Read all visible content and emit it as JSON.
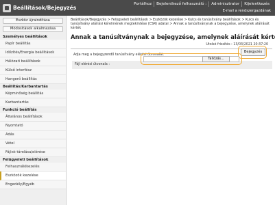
{
  "app": {
    "title": "Beállítások/Bejegyzés",
    "top_links": [
      "Portálhoz",
      "Bejelentkező felhasználó :",
      "Adminisztrator",
      "Kijelentkezés"
    ],
    "mail_link": "E-mail a rendszergazdának"
  },
  "sidebar": {
    "buttons": [
      "Eszköz újraindítása",
      "Módosítások alkalmazása"
    ],
    "sections": [
      {
        "title": "Személyes beállítások",
        "items": [
          "Papír beállítás",
          "Időzítés/Energia beállítások",
          "Hálózati beállítások",
          "Külső interfész",
          "Hangerő beállítás"
        ]
      },
      {
        "title": "Beállítás/Karbantartás",
        "items": [
          "Képminőség beállítás",
          "Karbantartás"
        ]
      },
      {
        "title": "Funkció beállítás",
        "items": [
          "Általános beállítások",
          "Nyomtató",
          "Adás",
          "Vétel",
          "Fájlok tárolása/elérése"
        ]
      },
      {
        "title": "Felügyeleti beállítások",
        "items": [
          "Felhasználókezelés",
          "Eszközök kezelése",
          "Engedély/Egyéb"
        ]
      }
    ],
    "selected_item": "Eszközök kezelése"
  },
  "main": {
    "breadcrumb": "Beállítások/Bejegyzés > Felügyeleti beállítások > Eszközök kezelése > Kulcs és tanúsítvány beállítások > Kulcs és tanúsítvány aláírási kérelmének megtekintése (CSR) adatai > Annak a tanúsítványnak a bejegyzése, amelynek aláírását kérték",
    "title": "Annak a tanúsítványnak a bejegyzése, amelynek aláírását kérték",
    "last_updated": "Utolsó frissítés : 13/03/2021 20:37:20",
    "submit_label": "Bejegyzés",
    "instruction": "Adja meg a bejegyzendő tanúsítvány elérési útvonalát.",
    "file_path_label": "Fájl elérési útvonala :",
    "browse_label": "Tallózás...",
    "file_path_value": ""
  }
}
